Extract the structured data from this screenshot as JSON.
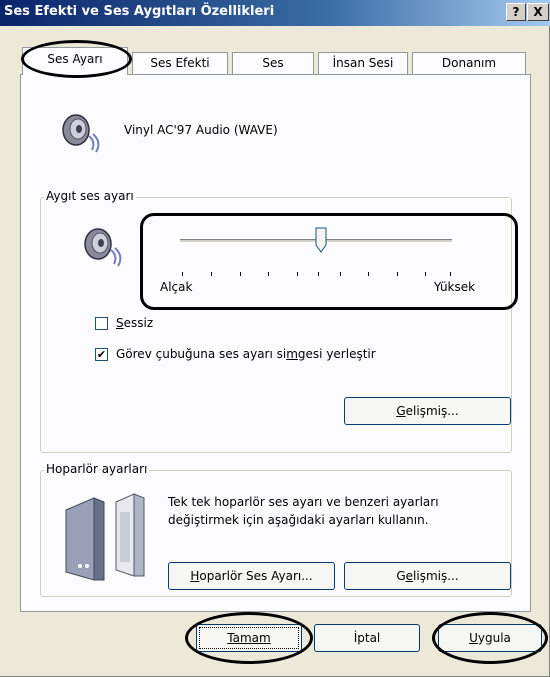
{
  "window": {
    "title": "Ses Efekti ve Ses Aygıtları Özellikleri",
    "help_label": "?",
    "close_label": "X"
  },
  "tabs": [
    {
      "label": "Ses Ayarı",
      "selected": true
    },
    {
      "label": "Ses Efekti",
      "selected": false
    },
    {
      "label": "Ses",
      "selected": false
    },
    {
      "label": "İnsan Sesi",
      "selected": false
    },
    {
      "label": "Donanım",
      "selected": false
    }
  ],
  "device": {
    "icon": "speaker-icon",
    "name": "Vinyl AC'97 Audio (WAVE)"
  },
  "volume_group": {
    "title": "Aygıt ses ayarı",
    "icon": "speaker-icon",
    "slider": {
      "level_fraction": 0.5,
      "low_label": "Alçak",
      "high_label": "Yüksek"
    },
    "mute": {
      "label_prefix": "",
      "label_hotkey": "S",
      "label_rest": "essiz",
      "checked": false
    },
    "tray_icon": {
      "label_before": "Görev çubuğuna ses ayarı si",
      "label_hotkey": "m",
      "label_after": "gesi yerleştir",
      "checked": true
    },
    "advanced_button": {
      "hotkey": "G",
      "rest": "elişmiş..."
    }
  },
  "speaker_group": {
    "title": "Hoparlör ayarları",
    "icon": "speakers-icon",
    "description_line1": "Tek tek hoparlör ses ayarı ve benzeri ayarları",
    "description_line2": "değiştirmek için aşağıdaki ayarları kullanın.",
    "speaker_volume_button": {
      "hotkey": "H",
      "rest": "oparlör Ses Ayarı..."
    },
    "advanced_button": {
      "before": "G",
      "hotkey": "e",
      "rest": "lişmiş..."
    }
  },
  "footer": {
    "ok_label": "Tamam",
    "cancel_label": "İptal",
    "apply_hotkey": "U",
    "apply_rest": "ygula"
  },
  "colors": {
    "titlebar_start": "#0a246a",
    "dialog_bg": "#ece9d8",
    "panel_bg": "#fcfcfe"
  }
}
